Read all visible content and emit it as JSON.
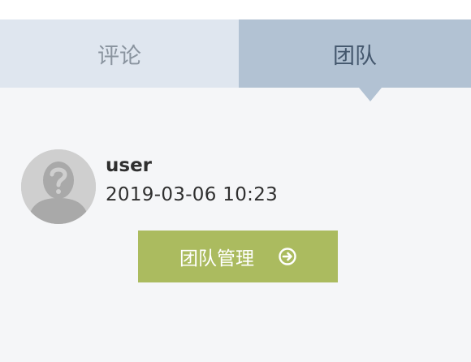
{
  "tabs": [
    {
      "label": "评论",
      "active": false
    },
    {
      "label": "团队",
      "active": true
    }
  ],
  "team": {
    "members": [
      {
        "name": "user",
        "joined": "2019-03-06 10:23",
        "avatar": "unknown-user-avatar"
      }
    ],
    "manage_button": {
      "label": "团队管理",
      "icon": "arrow-circle-right-icon"
    }
  },
  "colors": {
    "tab_inactive_bg": "#dfe6ef",
    "tab_active_bg": "#b2c2d3",
    "button_bg": "#abbb5f",
    "page_bg": "#f5f6f8"
  }
}
